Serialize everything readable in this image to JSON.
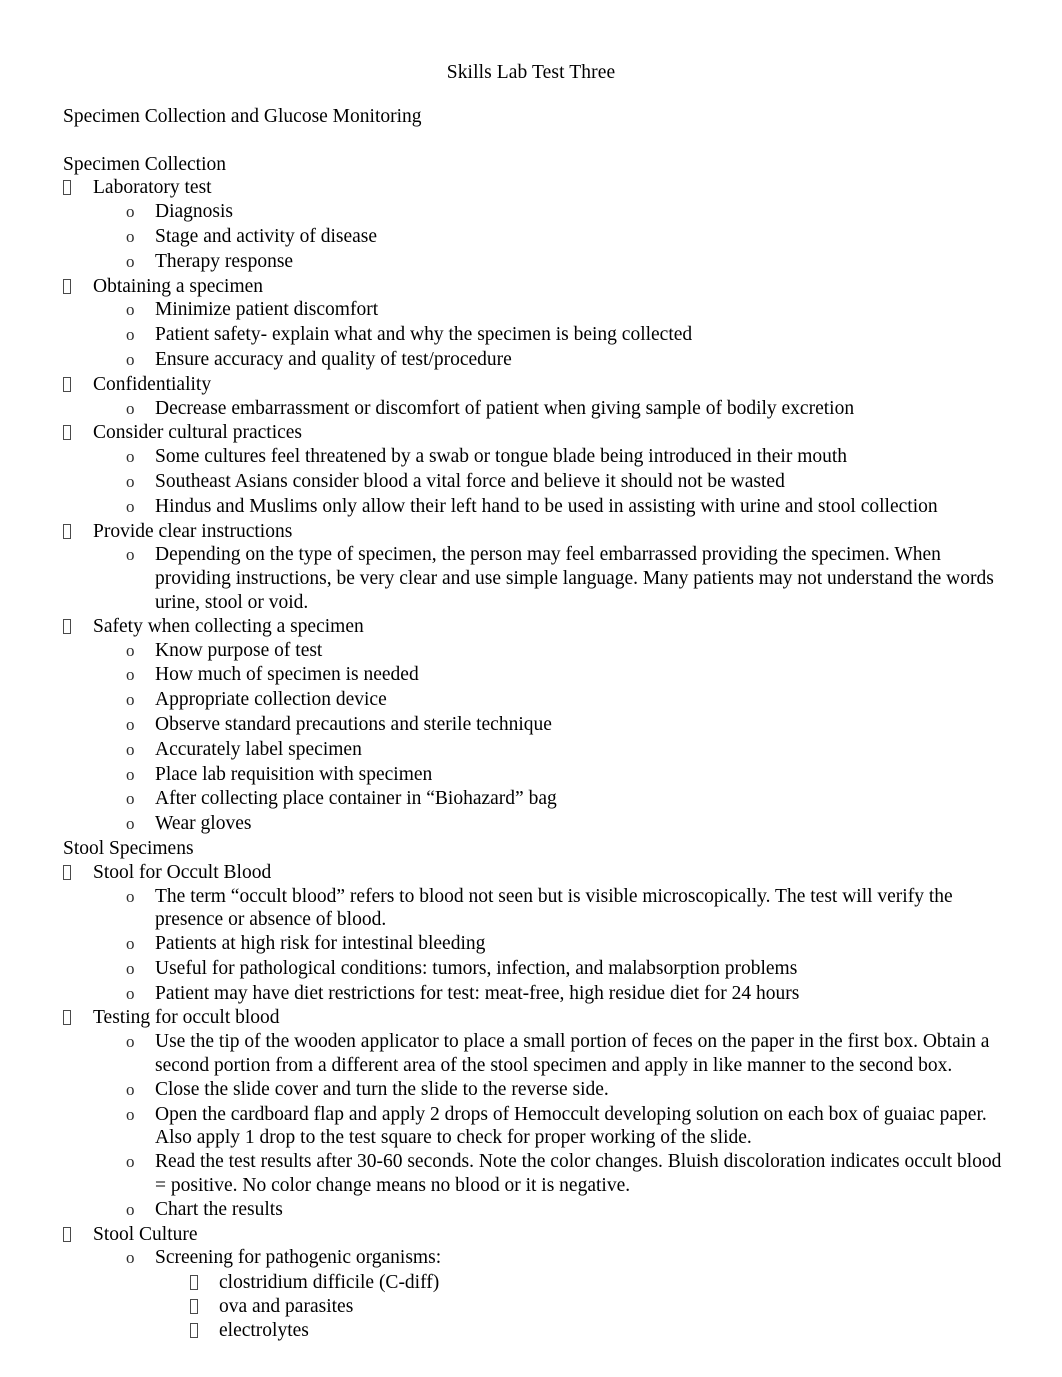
{
  "document": {
    "title": "Skills Lab Test Three",
    "subtitle": "Specimen Collection and Glucose Monitoring",
    "markers": {
      "level1": "missing-glyph-box",
      "level2": "o",
      "level3": "missing-glyph-box"
    },
    "colors": {
      "text": "#000000",
      "background": "#ffffff",
      "bullet": "#4a4a4a"
    },
    "sections": [
      {
        "heading": "Specimen Collection",
        "items": [
          {
            "level": 1,
            "text": "Laboratory test",
            "children": [
              {
                "level": 2,
                "text": "Diagnosis"
              },
              {
                "level": 2,
                "text": "Stage and activity of disease"
              },
              {
                "level": 2,
                "text": "Therapy response"
              }
            ]
          },
          {
            "level": 1,
            "text": "Obtaining a specimen",
            "children": [
              {
                "level": 2,
                "text": "Minimize patient discomfort"
              },
              {
                "level": 2,
                "text": "Patient safety- explain what and why the specimen is being collected"
              },
              {
                "level": 2,
                "text": "Ensure accuracy and quality of test/procedure"
              }
            ]
          },
          {
            "level": 1,
            "text": "Confidentiality",
            "children": [
              {
                "level": 2,
                "text": "Decrease embarrassment or discomfort of patient when giving sample of bodily excretion"
              }
            ]
          },
          {
            "level": 1,
            "text": "Consider cultural practices",
            "children": [
              {
                "level": 2,
                "text": "Some cultures feel threatened by a swab or tongue blade being introduced in their mouth"
              },
              {
                "level": 2,
                "text": "Southeast Asians consider blood a vital force and believe it should not be wasted"
              },
              {
                "level": 2,
                "text": "Hindus and Muslims only allow their left hand to be used in assisting with urine and stool collection"
              }
            ]
          },
          {
            "level": 1,
            "text": "Provide clear instructions",
            "children": [
              {
                "level": 2,
                "text": "Depending on the type of specimen, the person may feel embarrassed providing the specimen. When providing instructions, be very clear and use simple language. Many patients may not understand the words urine, stool or void."
              }
            ]
          },
          {
            "level": 1,
            "text": "Safety when collecting a specimen",
            "children": [
              {
                "level": 2,
                "text": "Know purpose of test"
              },
              {
                "level": 2,
                "text": "How much of specimen is needed"
              },
              {
                "level": 2,
                "text": "Appropriate collection device"
              },
              {
                "level": 2,
                "text": "Observe standard precautions and sterile technique"
              },
              {
                "level": 2,
                "text": "Accurately label specimen"
              },
              {
                "level": 2,
                "text": "Place lab requisition with specimen"
              },
              {
                "level": 2,
                "text": "After collecting place container in “Biohazard” bag"
              },
              {
                "level": 2,
                "text": "Wear gloves"
              }
            ]
          }
        ]
      },
      {
        "heading": "Stool Specimens",
        "items": [
          {
            "level": 1,
            "text": "Stool for Occult Blood",
            "children": [
              {
                "level": 2,
                "text": "The term “occult blood” refers to blood not seen but is visible microscopically.  The test will verify the presence or absence of blood."
              },
              {
                "level": 2,
                "text": "Patients at high risk for intestinal bleeding"
              },
              {
                "level": 2,
                "text": "Useful for pathological conditions: tumors, infection, and malabsorption problems"
              },
              {
                "level": 2,
                "text": "Patient may have diet restrictions for test: meat-free, high residue diet for 24 hours"
              }
            ]
          },
          {
            "level": 1,
            "text": "Testing for occult blood",
            "children": [
              {
                "level": 2,
                "text": "Use the tip of the wooden applicator to place a small portion of feces on the paper in the first box.  Obtain a second portion from a different area of the stool specimen and apply in like manner to the second box."
              },
              {
                "level": 2,
                "text": "Close the slide cover and turn the slide to the reverse side."
              },
              {
                "level": 2,
                "text": "Open the cardboard flap and apply 2 drops of Hemoccult developing solution on each box of guaiac paper.  Also apply 1 drop to the test square to check for proper working of the slide."
              },
              {
                "level": 2,
                "text": "Read the test results after 30-60 seconds.  Note the color changes.  Bluish discoloration indicates occult blood = positive.  No color change means no blood or it is negative."
              },
              {
                "level": 2,
                "text": "Chart the results"
              }
            ]
          },
          {
            "level": 1,
            "text": "Stool Culture",
            "children": [
              {
                "level": 2,
                "text": "Screening for pathogenic organisms:",
                "children": [
                  {
                    "level": 3,
                    "text": "clostridium difficile (C-diff)"
                  },
                  {
                    "level": 3,
                    "text": "ova and parasites"
                  },
                  {
                    "level": 3,
                    "text": "electrolytes"
                  }
                ]
              }
            ]
          }
        ]
      }
    ]
  }
}
